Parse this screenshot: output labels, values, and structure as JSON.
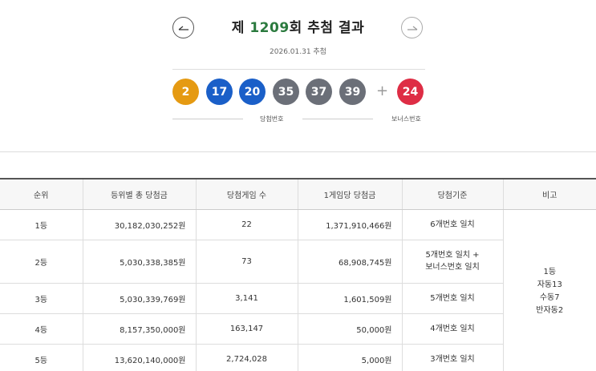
{
  "header": {
    "title_prefix": "제 ",
    "round_number": "1209",
    "title_suffix": "회 추첨 결과",
    "draw_date": "2026.01.31 추첨",
    "prev_icon": "arrow-left-icon",
    "next_icon": "arrow-right-icon"
  },
  "numbers": {
    "main": [
      {
        "value": "2",
        "color": "#e59a12"
      },
      {
        "value": "17",
        "color": "#1a5fc8"
      },
      {
        "value": "20",
        "color": "#1a5fc8"
      },
      {
        "value": "35",
        "color": "#6b6f78"
      },
      {
        "value": "37",
        "color": "#6b6f78"
      },
      {
        "value": "39",
        "color": "#6b6f78"
      }
    ],
    "plus_sign": "+",
    "bonus": {
      "value": "24",
      "color": "#de2d45"
    },
    "main_caption": "당첨번호",
    "bonus_caption": "보너스번호"
  },
  "table": {
    "headers": [
      "순위",
      "등위별 총 당첨금",
      "당첨게임 수",
      "1게임당 당첨금",
      "당첨기준",
      "비고"
    ],
    "rows": [
      {
        "rank": "1등",
        "total": "30,182,030,252원",
        "winners": "22",
        "per_game": "1,371,910,466원",
        "basis": [
          "6개번호 일치"
        ]
      },
      {
        "rank": "2등",
        "total": "5,030,338,385원",
        "winners": "73",
        "per_game": "68,908,745원",
        "basis": [
          "5개번호 일치 +",
          "보너스번호 일치"
        ]
      },
      {
        "rank": "3등",
        "total": "5,030,339,769원",
        "winners": "3,141",
        "per_game": "1,601,509원",
        "basis": [
          "5개번호 일치"
        ]
      },
      {
        "rank": "4등",
        "total": "8,157,350,000원",
        "winners": "163,147",
        "per_game": "50,000원",
        "basis": [
          "4개번호 일치"
        ]
      },
      {
        "rank": "5등",
        "total": "13,620,140,000원",
        "winners": "2,724,028",
        "per_game": "5,000원",
        "basis": [
          "3개번호 일치"
        ]
      }
    ],
    "note": [
      "1등",
      "자동13",
      "수동7",
      "반자동2"
    ]
  }
}
